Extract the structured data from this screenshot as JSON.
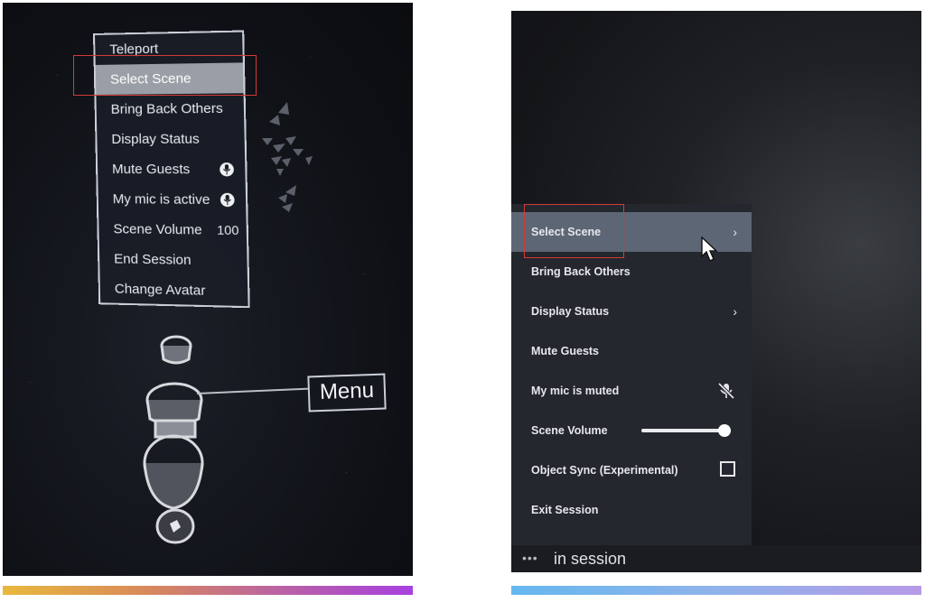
{
  "left_menu": {
    "items": [
      {
        "label": "Teleport"
      },
      {
        "label": "Select Scene"
      },
      {
        "label": "Bring Back Others"
      },
      {
        "label": "Display Status"
      },
      {
        "label": "Mute Guests",
        "icon": "mic-icon"
      },
      {
        "label": "My mic is active",
        "icon": "mic-icon"
      },
      {
        "label": "Scene Volume",
        "value": "100"
      },
      {
        "label": "End Session"
      },
      {
        "label": "Change Avatar"
      }
    ],
    "selected_index": 1,
    "menu_tag": "Menu"
  },
  "right_menu": {
    "items": [
      {
        "label": "Select Scene",
        "icon": "chevron-right-icon"
      },
      {
        "label": "Bring Back Others"
      },
      {
        "label": "Display Status",
        "icon": "chevron-right-icon"
      },
      {
        "label": "Mute Guests"
      },
      {
        "label": "My mic is muted",
        "icon": "mic-off-icon"
      },
      {
        "label": "Scene Volume",
        "slider_level": 1.0
      },
      {
        "label": "Object Sync (Experimental)",
        "checkbox_checked": false
      },
      {
        "label": "Exit Session"
      }
    ],
    "selected_index": 0,
    "chevron": "›",
    "status": {
      "dots": "•••",
      "text": "in session"
    }
  },
  "colors": {
    "highlight_left": "#9a9ea6",
    "highlight_right": "#5d6675",
    "annotation_red": "#d23a3a",
    "gradient_left": [
      "#e8b93d",
      "#a740e0"
    ],
    "gradient_right": [
      "#66b7ef",
      "#b69ae8"
    ]
  }
}
